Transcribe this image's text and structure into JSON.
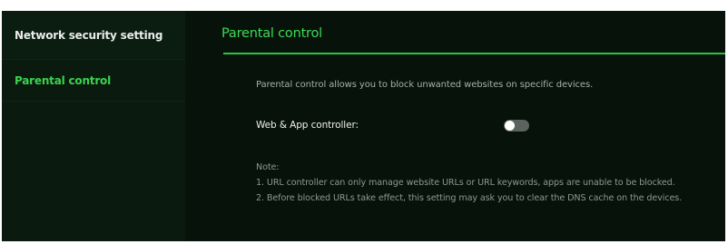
{
  "sidebar": {
    "items": [
      {
        "label": "Network security setting",
        "active": false
      },
      {
        "label": "Parental control",
        "active": true
      }
    ]
  },
  "main": {
    "title": "Parental control",
    "description": "Parental control allows you to block unwanted websites on specific devices.",
    "toggle": {
      "label": "Web & App controller:",
      "state": "off"
    },
    "note": {
      "heading": "Note:",
      "lines": [
        "1. URL controller can only manage website URLs or URL keywords, apps are unable to be blocked.",
        "2. Before blocked URLs take effect, this setting may ask you to clear the DNS cache on the devices."
      ]
    }
  },
  "colors": {
    "accent": "#3ddb55",
    "background": "#07120b",
    "sidebar_background": "#0a1a0e",
    "toggle_off": "#5b635e"
  }
}
